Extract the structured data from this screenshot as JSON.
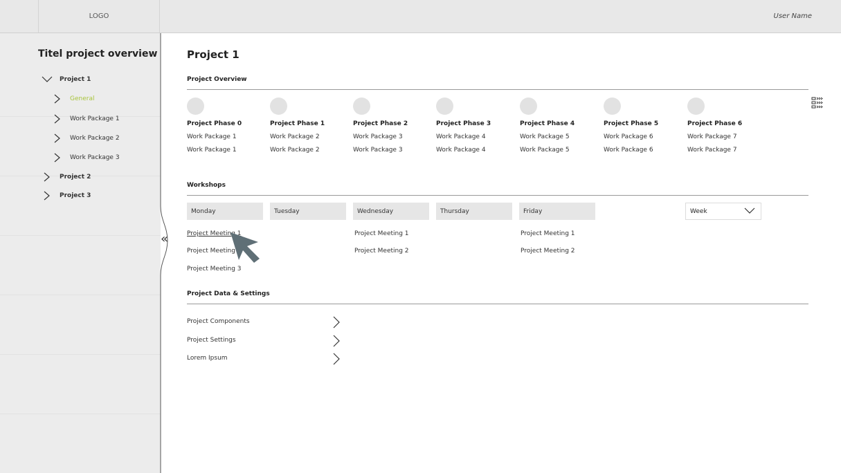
{
  "header": {
    "logo": "LOGO",
    "user_name": "User Name"
  },
  "sidebar": {
    "title": "Titel project overview",
    "items": [
      {
        "label": "Project 1",
        "icon": "chevron-down-icon"
      },
      {
        "label": "General",
        "icon": "chevron-right-icon",
        "active": true
      },
      {
        "label": "Work Package 1",
        "icon": "chevron-right-icon"
      },
      {
        "label": "Work Package 2",
        "icon": "chevron-right-icon"
      },
      {
        "label": "Work Package 3",
        "icon": "chevron-right-icon"
      },
      {
        "label": "Project 2",
        "icon": "chevron-right-icon"
      },
      {
        "label": "Project 3",
        "icon": "chevron-right-icon"
      }
    ],
    "collapse_label": "«"
  },
  "main": {
    "title": "Project 1",
    "overview": {
      "title": "Project Overview",
      "phases": [
        {
          "name": "Project Phase 0",
          "wp": [
            "Work Package 1",
            "Work Package 1"
          ]
        },
        {
          "name": "Project Phase 1",
          "wp": [
            "Work Package 2",
            "Work Package 2"
          ]
        },
        {
          "name": "Project Phase 2",
          "wp": [
            "Work Package 3",
            "Work Package 3"
          ]
        },
        {
          "name": "Project Phase 3",
          "wp": [
            "Work Package 4",
            "Work Package 4"
          ]
        },
        {
          "name": "Project Phase 4",
          "wp": [
            "Work Package 5",
            "Work Package 5"
          ]
        },
        {
          "name": "Project Phase 5",
          "wp": [
            "Work Package 6",
            "Work Package 6"
          ]
        },
        {
          "name": "Project Phase 6",
          "wp": [
            "Work Package 7",
            "Work Package 7"
          ]
        }
      ]
    },
    "workshops": {
      "title": "Workshops",
      "days": [
        "Monday",
        "Tuesday",
        "Wednesday",
        "Thursday",
        "Friday"
      ],
      "view_select": "Week",
      "monday": [
        "Project Meeting 1",
        "Project Meeting 2",
        "Project Meeting 3"
      ],
      "wednesday": [
        "Project Meeting 1",
        "Project Meeting 2"
      ],
      "friday": [
        "Project Meeting 1",
        "Project Meeting 2"
      ]
    },
    "settings": {
      "title": "Project Data & Settings",
      "items": [
        "Project Components",
        "Project Settings",
        "Lorem Ipsum"
      ]
    }
  },
  "colors": {
    "active": "#a8c43a",
    "panel": "#ececec",
    "cursor": "#5f6f76"
  }
}
